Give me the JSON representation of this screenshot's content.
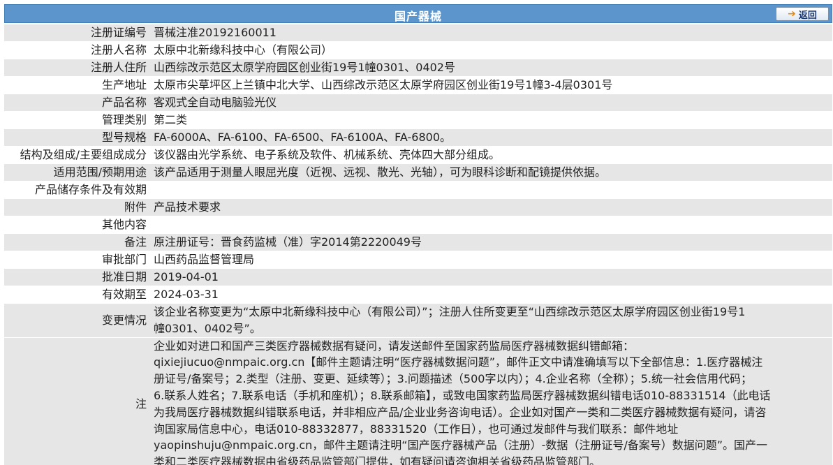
{
  "header": {
    "title": "国产器械",
    "back_label": "返回",
    "back_icon": "arrow-right-icon",
    "color": "#5b95cc"
  },
  "rows": [
    {
      "label": "注册证编号",
      "value": "晋械注准20192160011"
    },
    {
      "label": "注册人名称",
      "value": "太原中北新缘科技中心（有限公司）"
    },
    {
      "label": "注册人住所",
      "value": "山西综改示范区太原学府园区创业街19号1幢0301、0402号"
    },
    {
      "label": "生产地址",
      "value": "太原市尖草坪区上兰镇中北大学、山西综改示范区太原学府园区创业街19号1幢3-4层0301号"
    },
    {
      "label": "产品名称",
      "value": "客观式全自动电脑验光仪"
    },
    {
      "label": "管理类别",
      "value": "第二类"
    },
    {
      "label": "型号规格",
      "value": "FA-6000A、FA-6100、FA-6500、FA-6100A、FA-6800。"
    },
    {
      "label": "结构及组成/主要组成成分",
      "value": "该仪器由光学系统、电子系统及软件、机械系统、壳体四大部分组成。"
    },
    {
      "label": "适用范围/预期用途",
      "value": "该产品适用于测量人眼屈光度（近视、远视、散光、光轴），可为眼科诊断和配镜提供依据。"
    },
    {
      "label": "产品储存条件及有效期",
      "value": ""
    },
    {
      "label": "附件",
      "value": "产品技术要求"
    },
    {
      "label": "其他内容",
      "value": ""
    },
    {
      "label": "备注",
      "value": "原注册证号：晋食药监械（准）字2014第2220049号"
    },
    {
      "label": "审批部门",
      "value": "山西药品监督管理局"
    },
    {
      "label": "批准日期",
      "value": "2019-04-01"
    },
    {
      "label": "有效期至",
      "value": "2024-03-31"
    }
  ],
  "change": {
    "label": "变更情况",
    "line1": "该企业名称变更为“太原中北新缘科技中心（有限公司）”；注册人住所变更至“山西综改示范区太原学府园区创业街19号1",
    "line2": "幢0301、0402号”。"
  },
  "note": {
    "label": "注",
    "lines": [
      "企业如对进口和国产三类医疗器械数据有疑问，请发送邮件至国家药监局医疗器械数据纠错邮箱：",
      "qixiejiucuo@nmpaic.org.cn【邮件主题请注明“医疗器械数据问题”，邮件正文中请准确填写以下全部信息：1.医疗器械注",
      "册证号/备案号；2.类型（注册、变更、延续等）；3.问题描述（500字以内）；4.企业名称（全称）；5.统一社会信用代码；",
      "6.联系人姓名；7.联系电话（手机和座机）；8.联系邮箱】，或致电国家药监局医疗器械数据纠错电话010-88331514（此电话",
      "为我局医疗器械数据纠错联系电话，并非相应产品/企业业务咨询电话）。企业如对国产一类和二类医疗器械数据有疑问，请咨",
      "询国家局信息中心，电话010-88332877，88331520（工作日），也可通过发邮件与我们联系：邮件地址",
      "yaopinshuju@nmpaic.org.cn，邮件主题请注明“国产医疗器械产品（注册）-数据（注册证号/备案号）数据问题”。国产一",
      "类和二类医疗器械数据由省级药品监管部门提供，如有疑问请咨询相关省级药品监管部门。"
    ]
  }
}
